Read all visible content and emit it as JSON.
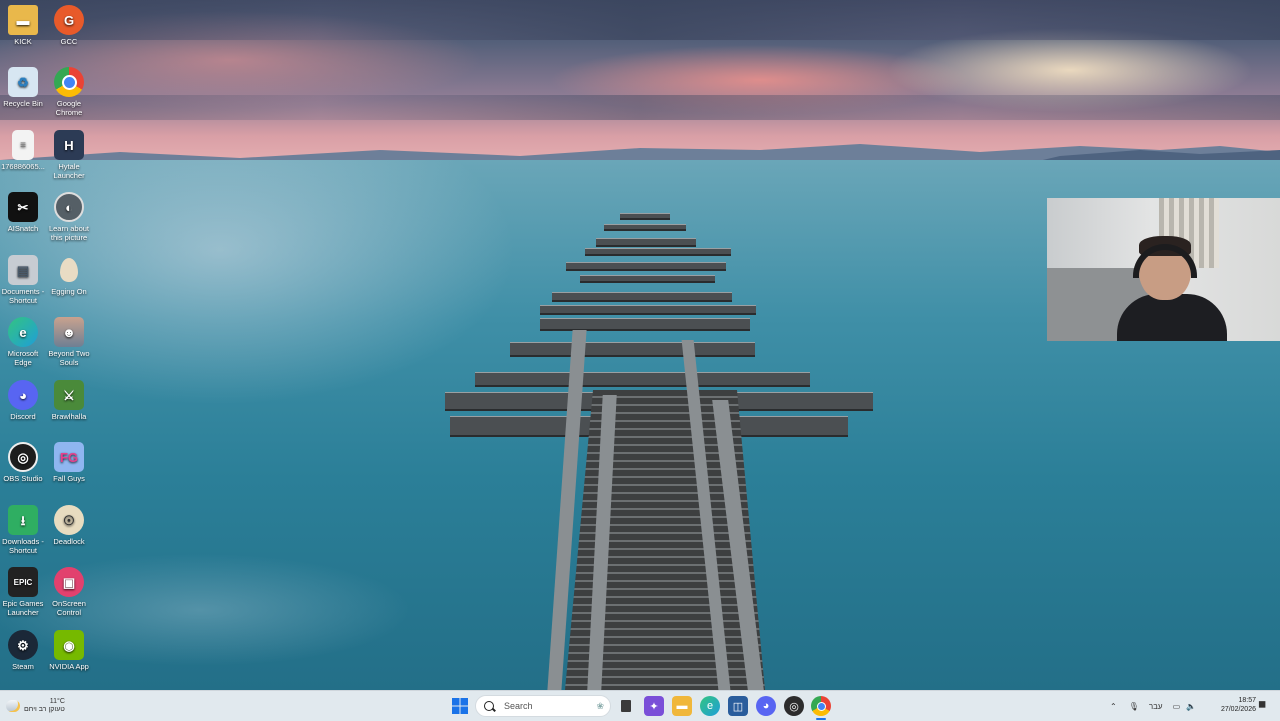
{
  "desktop": {
    "icons": [
      {
        "label": "KICK",
        "icon": "folder-icon",
        "color": "#e9b84b"
      },
      {
        "label": "GCC",
        "icon": "gcc-icon",
        "color": "#e85a2a"
      },
      {
        "label": "Recycle Bin",
        "icon": "recycle-bin-icon",
        "color": "#d7e6f2"
      },
      {
        "label": "Google Chrome",
        "icon": "chrome-icon",
        "color": "#ffffff"
      },
      {
        "label": "176886065...",
        "icon": "file-icon",
        "color": "#f3f3f3"
      },
      {
        "label": "Hytale Launcher",
        "icon": "hytale-icon",
        "color": "#2c3b55"
      },
      {
        "label": "AISnatch",
        "icon": "aisnatch-icon",
        "color": "#111111"
      },
      {
        "label": "Learn about this picture",
        "icon": "learn-picture-icon",
        "color": "#555f66"
      },
      {
        "label": "Documents - Shortcut",
        "icon": "documents-icon",
        "color": "#c7ccd2"
      },
      {
        "label": "Egging On",
        "icon": "egg-icon",
        "color": "#e9dcc4"
      },
      {
        "label": "Microsoft Edge",
        "icon": "edge-icon",
        "color": "#1f9ed8"
      },
      {
        "label": "Beyond Two Souls",
        "icon": "game-icon",
        "color": "#6e7f93"
      },
      {
        "label": "Discord",
        "icon": "discord-icon",
        "color": "#5865f2"
      },
      {
        "label": "Brawlhalla",
        "icon": "brawlhalla-icon",
        "color": "#4a8a3a"
      },
      {
        "label": "OBS Studio",
        "icon": "obs-icon",
        "color": "#1d1d1d"
      },
      {
        "label": "Fall Guys",
        "icon": "fall-guys-icon",
        "color": "#8fb6f0"
      },
      {
        "label": "Downloads - Shortcut",
        "icon": "downloads-icon",
        "color": "#2fae62"
      },
      {
        "label": "Deadlock",
        "icon": "deadlock-icon",
        "color": "#e8dcc0"
      },
      {
        "label": "Epic Games Launcher",
        "icon": "epic-games-icon",
        "color": "#222222"
      },
      {
        "label": "OnScreen Control",
        "icon": "onscreen-control-icon",
        "color": "#e2416e"
      },
      {
        "label": "Steam",
        "icon": "steam-icon",
        "color": "#1b2838"
      },
      {
        "label": "NVIDIA App",
        "icon": "nvidia-icon",
        "color": "#76b900"
      }
    ]
  },
  "taskbar": {
    "weather": {
      "temp": "11°C",
      "desc": "טעוקן רב ויחם"
    },
    "search": {
      "placeholder": "Search"
    },
    "apps": [
      {
        "icon": "windows-start-icon",
        "color": "#1a73e8"
      },
      {
        "icon": "task-view-icon",
        "color": "#3a3a3a"
      },
      {
        "icon": "copilot-icon",
        "color": "#7a4fd8"
      },
      {
        "icon": "file-explorer-icon",
        "color": "#f0b73a"
      },
      {
        "icon": "edge-icon",
        "color": "#1f9ed8"
      },
      {
        "icon": "store-icon",
        "color": "#2a5d9c"
      },
      {
        "icon": "discord-icon",
        "color": "#5865f2"
      },
      {
        "icon": "obs-icon",
        "color": "#2c2c2c"
      },
      {
        "icon": "chrome-icon",
        "color": "#e8453c"
      }
    ],
    "tray": {
      "lang": "עבר"
    },
    "clock": {
      "time": "18:57",
      "date": "27/02/2026"
    }
  }
}
